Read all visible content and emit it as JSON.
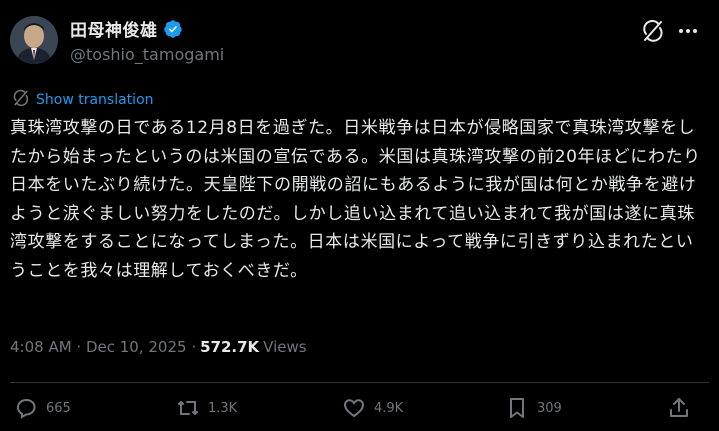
{
  "author": {
    "display_name": "田母神俊雄",
    "handle": "@toshio_tamogami",
    "avatar": "avatar-photo",
    "verified_icon": "verified-badge-icon"
  },
  "header_icons": [
    "grok-icon",
    "more-icon"
  ],
  "translation": {
    "label": "Show translation",
    "icon": "translate-icon"
  },
  "post": {
    "text": "真珠湾攻撃の日である12月8日を過ぎた。日米戦争は日本が侵略国家で真珠湾攻撃をしたから始まったというのは米国の宣伝である。米国は真珠湾攻撃の前20年ほどにわたり日本をいたぶり続けた。天皇陛下の開戦の詔にもあるように我が国は何とか戦争を避けようと涙ぐましい努力をしたのだ。しかし追い込まれて追い込まれて我が国は遂に真珠湾攻撃をすることになってしまった。日本は米国によって戦争に引きずり込まれたということを我々は理解しておくべきだ。",
    "timestamp": "4:08 AM · Dec 10, 2025 ·",
    "views_count": "572.7K",
    "views_label": "Views"
  },
  "actions": {
    "replies": "665",
    "reposts": "1.3K",
    "likes": "4.9K",
    "bookmarks": "309"
  },
  "colors": {
    "background": "#000000",
    "text": "#e7e9ea",
    "secondary": "#71767b",
    "accent": "#1d9bf0",
    "divider": "#2f3336"
  }
}
